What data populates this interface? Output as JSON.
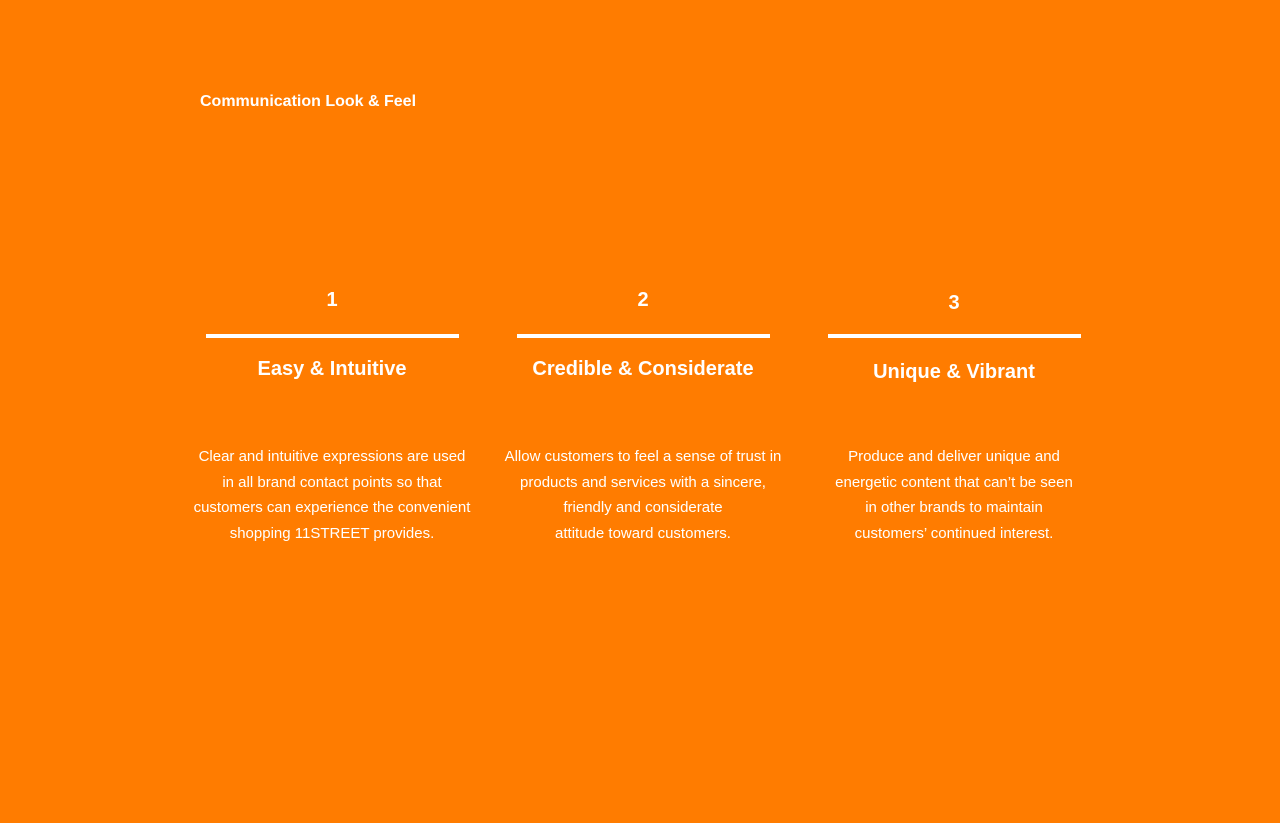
{
  "page": {
    "title": "Communication Look & Feel",
    "background_color": "#FF7C00",
    "text_color": "#FFFFFF"
  },
  "columns": [
    {
      "number": "1",
      "title": "Easy & Intuitive",
      "description_lines": [
        "Clear and intuitive expressions are used",
        "in all brand contact points so that",
        "customers can experience the convenient",
        "shopping 11STREET provides."
      ]
    },
    {
      "number": "2",
      "title": "Credible & Considerate",
      "description_lines": [
        "Allow customers to feel a sense of trust in",
        "products and services with a sincere,",
        "friendly and considerate",
        "attitude toward customers."
      ]
    },
    {
      "number": "3",
      "title": "Unique & Vibrant",
      "description_lines": [
        "Produce and deliver unique and",
        "energetic content that can’t be seen",
        "in other brands to maintain",
        "customers’ continued interest."
      ]
    }
  ]
}
